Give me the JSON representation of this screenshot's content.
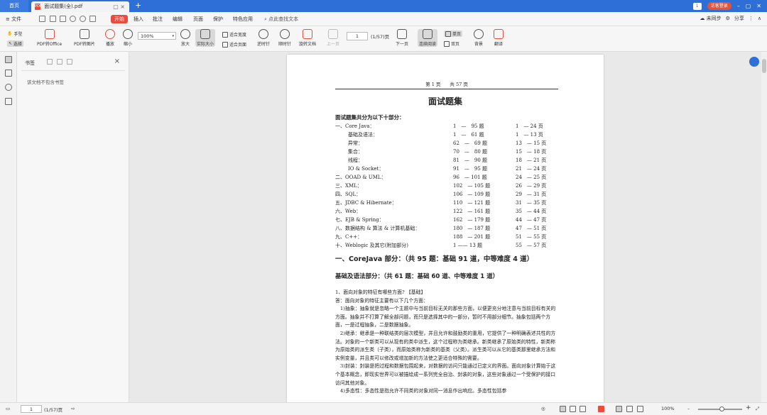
{
  "titlebar": {
    "home_tab": "首页",
    "doc_tab": "面试题集(全).pdf",
    "pdf_badge": "PDF",
    "add_tab": "+",
    "page_num_badge": "1",
    "login_label": "访客登录",
    "min": "–",
    "max": "▢",
    "close": "✕"
  },
  "menubar": {
    "file": "文件",
    "start": "开始",
    "insert": "插入",
    "annotate": "批注",
    "edit": "编辑",
    "page": "页面",
    "protect": "保护",
    "features": "特色应用",
    "search": "点此查找文本",
    "sync": "未同步",
    "share": "分享"
  },
  "toolbar": {
    "hand": "手型",
    "select": "选择",
    "pdf_to_office": "PDF转Office",
    "pdf_to_image": "PDF转图片",
    "play": "播放",
    "zoom_out": "缩小",
    "zoom_value": "100%",
    "zoom_in": "放大",
    "actual_size": "实际大小",
    "fit_width": "适合宽度",
    "fit_page": "适合页面",
    "rotate_ccw": "逆时针",
    "rotate_cw": "顺时针",
    "rotate_doc": "旋转文档",
    "prev_page": "上一页",
    "page_input": "1",
    "page_count": "(1/57)页",
    "next_page": "下一页",
    "continuous": "连续阅读",
    "single": "单页",
    "double": "双页",
    "background": "背景",
    "translate": "翻译"
  },
  "bookmarks": {
    "title": "书签",
    "close": "×",
    "empty_text": "该文档不包含书签"
  },
  "document": {
    "header": "第 1 页　　共 57 页",
    "title": "面试题集",
    "lead": "面试题集共分为以下十部分：",
    "toc": [
      {
        "name": "一、Core Java：",
        "range": "1　—　95 题",
        "pages": "1　— 24 页",
        "indent": false
      },
      {
        "name": "基础及语法：",
        "range": "1　—　61 题",
        "pages": "1　— 13 页",
        "indent": true
      },
      {
        "name": "异常：",
        "range": "62　—　69 题",
        "pages": "13　— 15 页",
        "indent": true
      },
      {
        "name": "集合：",
        "range": "70　—　80 题",
        "pages": "15　— 18 页",
        "indent": true
      },
      {
        "name": "线程：",
        "range": "81　—　90 题",
        "pages": "18　— 21 页",
        "indent": true
      },
      {
        "name": "IO & Socket：",
        "range": "91　—　95 题",
        "pages": "21　— 24 页",
        "indent": true
      },
      {
        "name": "二、OOAD & UML：",
        "range": "96　— 101 题",
        "pages": "24　— 25 页",
        "indent": false
      },
      {
        "name": "三、XML：",
        "range": "102　— 105 题",
        "pages": "26　— 29 页",
        "indent": false
      },
      {
        "name": "四、SQL：",
        "range": "106　— 109 题",
        "pages": "29　— 31 页",
        "indent": false
      },
      {
        "name": "五、JDBC & Hibernate：",
        "range": "110　— 121 题",
        "pages": "31　— 35 页",
        "indent": false
      },
      {
        "name": "六、Web：",
        "range": "122　— 161 题",
        "pages": "35　— 44 页",
        "indent": false
      },
      {
        "name": "七、EJB & Spring：",
        "range": "162　— 179 题",
        "pages": "44　— 47 页",
        "indent": false
      },
      {
        "name": "八、数据结构 & 算法 & 计算机基础：",
        "range": "180　— 187 题",
        "pages": "47　— 51 页",
        "indent": false
      },
      {
        "name": "九、C++：",
        "range": "188　— 201 题",
        "pages": "51　— 55 页",
        "indent": false
      },
      {
        "name": "十、Weblogic 及其它(附加部分)",
        "range": "1 —— 13 题",
        "pages": "55　— 57 页",
        "indent": false
      }
    ],
    "section_heading": "一、CoreJava 部分：（共 95 题：基础 91 道，中等难度 4 道）",
    "sub_heading": "基础及语法部分：（共 61 题：基础 60 道、中等难度 1 道）",
    "paragraphs": [
      "1、面向对象的特征有哪些方面? 【基础】",
      "答：面向对象的特征主要有以下几个方面：",
      "　1)抽象：抽象就是忽略一个主题中与当前目标无关的那些方面，以便更充分地注意与当前目标有关的方面。抽象并不打算了解全部问题，而只是选择其中的一部分，暂时不用部分细节。抽象包括两个方面，一是过程抽象，二是数据抽象。",
      "　2)继承：继承是一种联结类的层次模型，并且允许和鼓励类的重用，它提供了一种明确表述共性的方法。对象的一个新类可以从现有的类中派生，这个过程称为类继承。新类继承了原始类的特性，新类称为原始类的派生类（子类），而原始类称为新类的基类（父类）。派生类可以从它的基类那里继承方法和实例变量，并且类可以修改或增加新的方法使之更适合特殊的需要。",
      "　3)封装：封装是把过程和数据包围起来，对数据的访问只能通过已定义的界面。面向对象计算始于这个基本概念，即现实世界可以被描绘成一系列完全自治、封装的对象，这些对象通过一个受保护的接口访问其他对象。",
      "　4)多态性：多态性是指允许不同类的对象对同一消息作出响应。多态性包括参"
    ]
  },
  "statusbar": {
    "page_input": "1",
    "page_count": "(1/57)页",
    "zoom_value": "100%",
    "zoom_minus": "–",
    "zoom_plus": "+"
  },
  "colors": {
    "accent": "#2d6fd6",
    "brand_red": "#e84c3d"
  }
}
